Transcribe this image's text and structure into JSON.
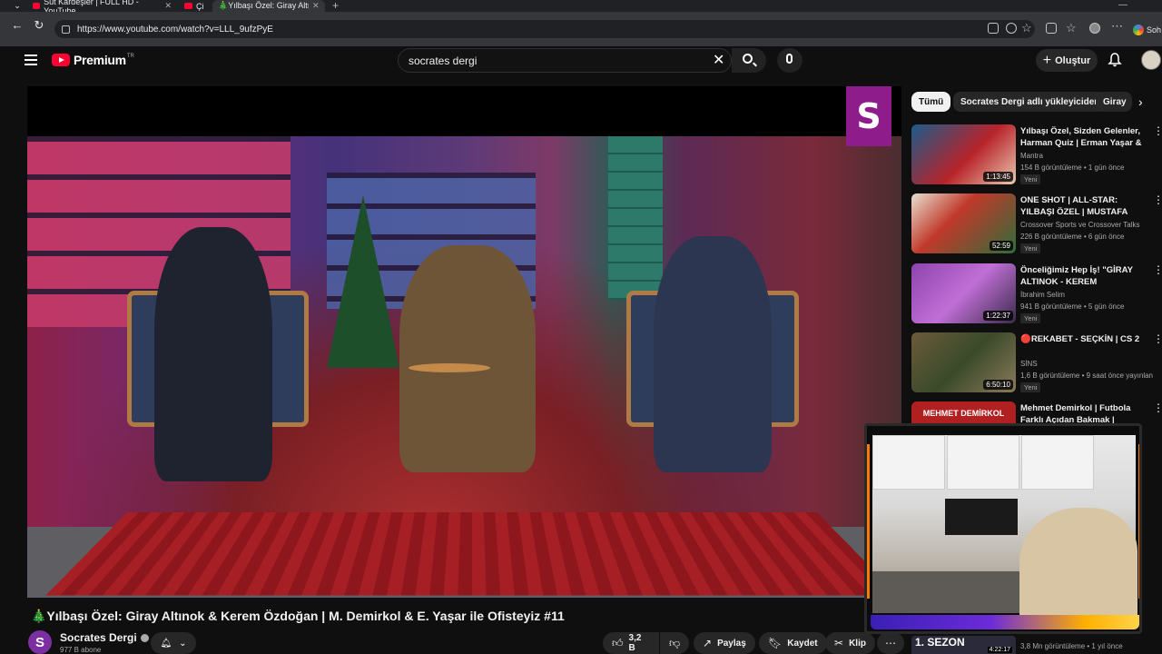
{
  "browser": {
    "tabs": [
      {
        "label": "Süt Kardeşler | FULL HD - YouTube"
      },
      {
        "label": "Çi"
      },
      {
        "label": "🎄Yılbaşı Özel: Giray Altınok"
      }
    ],
    "url": "https://www.youtube.com/watch?v=LLL_9ufzPyE",
    "side_label": "Soh"
  },
  "header": {
    "logo": "Premium",
    "logo_sup": "TR",
    "search_query": "socrates dergi",
    "create_label": "Oluştur"
  },
  "video": {
    "title": "🎄Yılbaşı Özel: Giray Altınok & Kerem Özdoğan | M. Demirkol & E. Yaşar ile Ofisteyiz #11",
    "badge_letter": "S",
    "channel": {
      "initial": "S",
      "name": "Socrates Dergi",
      "subscribers": "977 B abone"
    },
    "actions": {
      "likes": "3,2 B",
      "share": "Paylaş",
      "save": "Kaydet",
      "clip": "Klip"
    }
  },
  "chips": [
    {
      "label": "Tümü",
      "selected": true
    },
    {
      "label": "Socrates Dergi adlı yükleyiciden",
      "selected": false
    },
    {
      "label": "Giray",
      "selected": false
    }
  ],
  "recommendations": [
    {
      "title": "Yılbaşı Özel, Sizden Gelenler, Harman Quiz | Erman Yaşar & ...",
      "channel": "Mantra",
      "meta": "154 B görüntüleme • 1 gün önce",
      "badge": "Yeni",
      "duration": "1:13:45",
      "thumb_color": "#b8232a"
    },
    {
      "title": "ONE SHOT | ALL-STAR: YILBAŞI ÖZEL | MUSTAFA DEMİRTAŞ, ...",
      "channel": "Crossover Sports ve Crossover Talks",
      "meta": "226 B görüntüleme • 6 gün önce",
      "badge": "Yeni",
      "duration": "52:59",
      "thumb_color": "#c0392b"
    },
    {
      "title": "Önceliğimiz Hep İş! \"GİRAY ALTINOK - KEREM ÖZDOĞAN\" ...",
      "channel": "İbrahim Selim",
      "meta": "941 B görüntüleme • 5 gün önce",
      "badge": "Yeni",
      "duration": "1:22:37",
      "thumb_color": "#8e44ad"
    },
    {
      "title": "🔴REKABET - SEÇKİN | CS 2",
      "channel": "SİNS",
      "meta": "1,6 B görüntüleme • 9 saat önce yayınlan",
      "badge": "Yeni",
      "duration": "6:50:10",
      "thumb_color": "#6b5a3a"
    },
    {
      "title": "Mehmet Demirkol | Futbola Farklı Açıdan Bakmak | Kimsin...",
      "channel": "",
      "meta": "",
      "badge": "",
      "duration": "",
      "thumb_color": "#b02020",
      "thumb_text": "MEHMET DEMİRKOL"
    }
  ],
  "bottom_rec": {
    "thumb_text": "1. SEZON",
    "duration": "4:22:17",
    "meta": "3,8 Mn görüntüleme • 1 yıl önce"
  }
}
